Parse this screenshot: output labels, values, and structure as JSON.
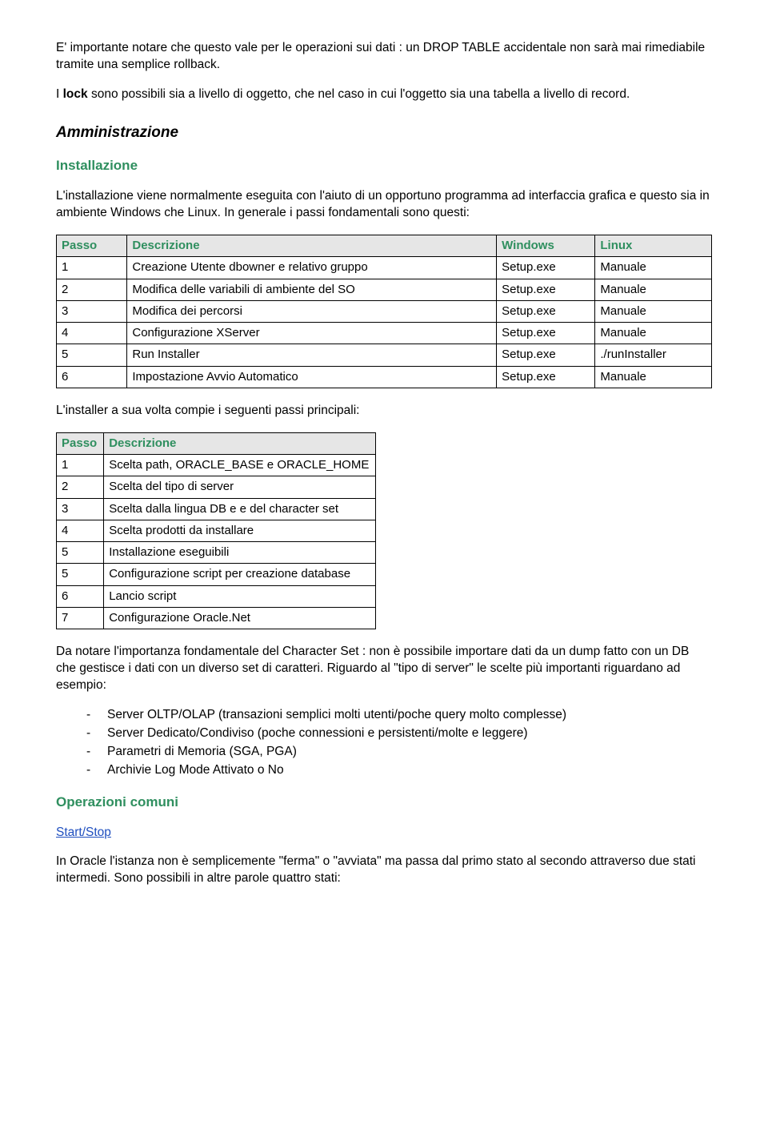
{
  "para1": {
    "pre": "E' importante notare che questo vale per le operazioni sui dati : un DROP TABLE accidentale non sarà mai rimediabile tramite una semplice rollback."
  },
  "para2": {
    "pre": "I ",
    "bold": "lock",
    "post": " sono possibili sia a livello di oggetto, che nel caso in cui l'oggetto sia una tabella a livello di record."
  },
  "h_admin": "Amministrazione",
  "h_install": "Installazione",
  "para3": "L'installazione viene normalmente eseguita con l'aiuto di un opportuno programma ad interfaccia grafica e questo sia in ambiente Windows che Linux. In generale i passi fondamentali sono questi:",
  "table1": {
    "headers": [
      "Passo",
      "Descrizione",
      "Windows",
      "Linux"
    ],
    "rows": [
      [
        "1",
        "Creazione Utente dbowner e relativo gruppo",
        "Setup.exe",
        "Manuale"
      ],
      [
        "2",
        "Modifica delle variabili di ambiente del SO",
        "Setup.exe",
        "Manuale"
      ],
      [
        "3",
        "Modifica dei percorsi",
        "Setup.exe",
        "Manuale"
      ],
      [
        "4",
        "Configurazione XServer",
        "Setup.exe",
        "Manuale"
      ],
      [
        "5",
        "Run Installer",
        "Setup.exe",
        "./runInstaller"
      ],
      [
        "6",
        "Impostazione Avvio Automatico",
        "Setup.exe",
        "Manuale"
      ]
    ]
  },
  "para4": "L'installer a sua volta compie i seguenti passi principali:",
  "table2": {
    "headers": [
      "Passo",
      "Descrizione"
    ],
    "rows": [
      [
        "1",
        "Scelta path, ORACLE_BASE e ORACLE_HOME"
      ],
      [
        "2",
        "Scelta del tipo di server"
      ],
      [
        "3",
        "Scelta dalla lingua DB e e del character set"
      ],
      [
        "4",
        "Scelta prodotti da installare"
      ],
      [
        "5",
        "Installazione eseguibili"
      ],
      [
        "5",
        "Configurazione script per creazione database"
      ],
      [
        "6",
        "Lancio script"
      ],
      [
        "7",
        "Configurazione Oracle.Net"
      ]
    ]
  },
  "para5": "Da notare l'importanza fondamentale del Character Set : non è possibile importare dati da un dump fatto con un DB che gestisce i dati con un diverso set di caratteri. Riguardo al \"tipo di server\" le scelte più importanti riguardano ad esempio:",
  "list1": [
    "Server OLTP/OLAP (transazioni semplici molti utenti/poche query molto complesse)",
    "Server Dedicato/Condiviso (poche connessioni e persistenti/molte e leggere)",
    "Parametri di Memoria (SGA, PGA)",
    "Archivie Log Mode Attivato o No"
  ],
  "h_ops": "Operazioni comuni",
  "link_start": "Start/Stop",
  "para6": "In Oracle l'istanza non è semplicemente \"ferma\" o \"avviata\" ma passa dal primo stato al secondo attraverso due stati intermedi. Sono possibili in altre parole quattro stati:"
}
